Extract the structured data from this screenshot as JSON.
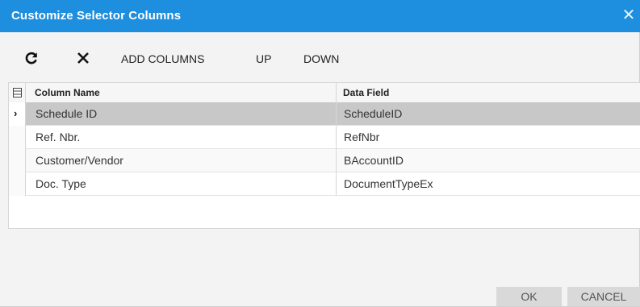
{
  "dialog": {
    "title": "Customize Selector Columns",
    "close_icon": "close-icon"
  },
  "toolbar": {
    "refresh_icon": "refresh-icon",
    "delete_icon": "delete-x-icon",
    "add_columns_label": "ADD COLUMNS",
    "up_label": "UP",
    "down_label": "DOWN"
  },
  "grid": {
    "columns": [
      "Column Name",
      "Data Field"
    ],
    "rows": [
      {
        "column_name": "Schedule ID",
        "data_field": "ScheduleID",
        "selected": true
      },
      {
        "column_name": "Ref. Nbr.",
        "data_field": "RefNbr",
        "selected": false
      },
      {
        "column_name": "Customer/Vendor",
        "data_field": "BAccountID",
        "selected": false
      },
      {
        "column_name": "Doc. Type",
        "data_field": "DocumentTypeEx",
        "selected": false
      }
    ]
  },
  "footer": {
    "ok_label": "OK",
    "cancel_label": "CANCEL"
  },
  "colors": {
    "titlebar": "#1e8ede",
    "selected_row": "#c8c8c8"
  }
}
